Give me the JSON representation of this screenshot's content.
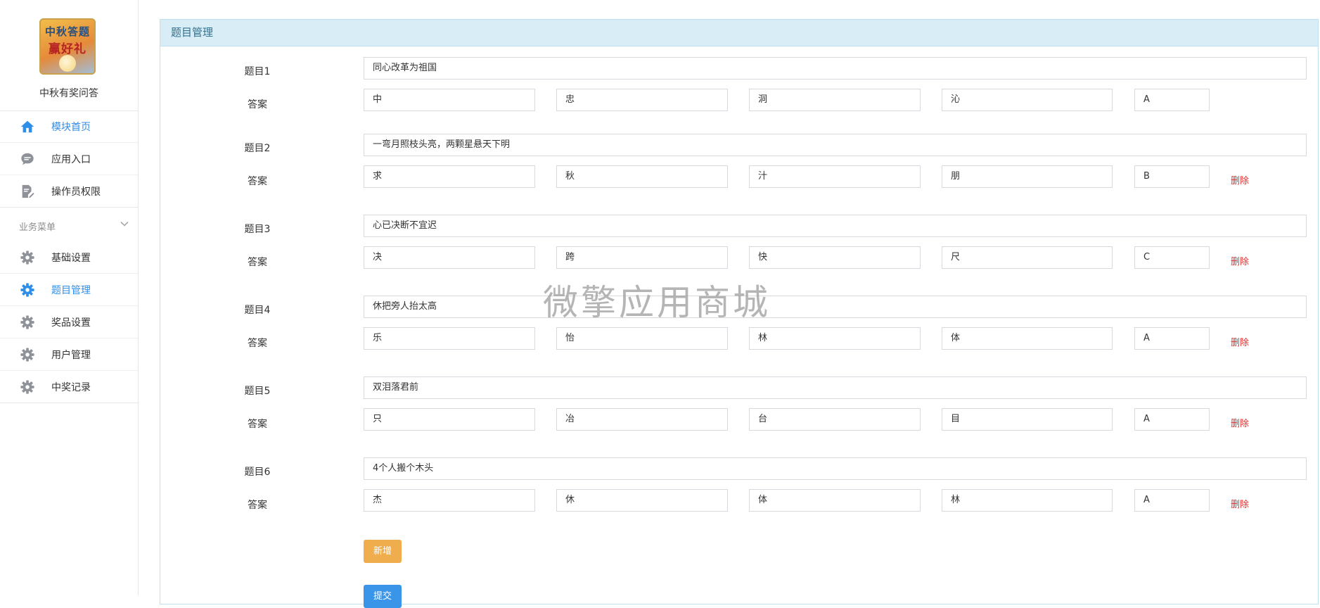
{
  "app": {
    "name": "中秋有奖问答",
    "logo_text_line1": "中秋答题",
    "logo_text_line2": "赢好礼"
  },
  "sidebar": {
    "top_items": [
      {
        "label": "模块首页",
        "icon": "home-icon",
        "active": true
      },
      {
        "label": "应用入口",
        "icon": "chat-icon",
        "active": false
      },
      {
        "label": "操作员权限",
        "icon": "document-edit-icon",
        "active": false
      }
    ],
    "group_label": "业务菜单",
    "group_items": [
      {
        "label": "基础设置",
        "icon": "gear-icon",
        "active": false
      },
      {
        "label": "题目管理",
        "icon": "gear-icon",
        "active": true
      },
      {
        "label": "奖品设置",
        "icon": "gear-icon",
        "active": false
      },
      {
        "label": "用户管理",
        "icon": "gear-icon",
        "active": false
      },
      {
        "label": "中奖记录",
        "icon": "gear-icon",
        "active": false
      }
    ]
  },
  "panel": {
    "title": "题目管理"
  },
  "answer_label": "答案",
  "delete_label": "删除",
  "questions": [
    {
      "label": "题目1",
      "text": "同心改革为祖国",
      "options": [
        "中",
        "忠",
        "洞",
        "沁"
      ],
      "answer": "A",
      "deletable": false
    },
    {
      "label": "题目2",
      "text": "一弯月照枝头亮，两颗星悬天下明",
      "options": [
        "求",
        "秋",
        "汁",
        "朋"
      ],
      "answer": "B",
      "deletable": true
    },
    {
      "label": "题目3",
      "text": "心已决断不宜迟",
      "options": [
        "决",
        "跨",
        "快",
        "尺"
      ],
      "answer": "C",
      "deletable": true
    },
    {
      "label": "题目4",
      "text": "休把旁人抬太高",
      "options": [
        "乐",
        "怡",
        "林",
        "体"
      ],
      "answer": "A",
      "deletable": true
    },
    {
      "label": "题目5",
      "text": "双泪落君前",
      "options": [
        "只",
        "冶",
        "台",
        "目"
      ],
      "answer": "A",
      "deletable": true
    },
    {
      "label": "题目6",
      "text": "4个人搬个木头",
      "options": [
        "杰",
        "休",
        "体",
        "林"
      ],
      "answer": "A",
      "deletable": true
    }
  ],
  "buttons": {
    "add": "新增",
    "submit": "提交"
  },
  "watermark": "微擎应用商城",
  "colors": {
    "accent": "#2f8ee8",
    "panel_header": "#d9edf7",
    "add_button": "#f0ad4e",
    "submit_button": "#3a95e8",
    "delete": "#e52c2c"
  }
}
